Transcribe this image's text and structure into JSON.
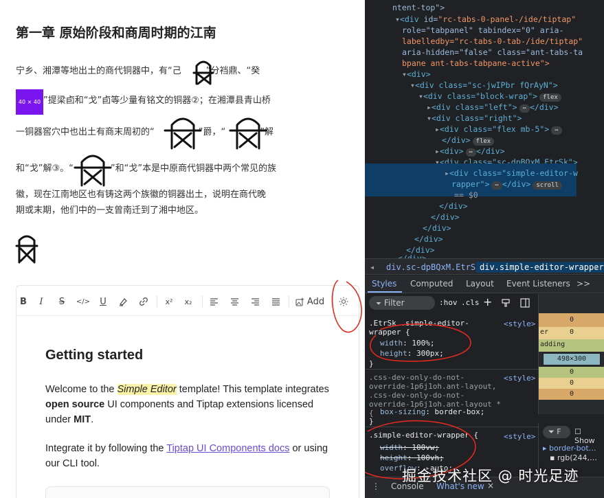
{
  "article": {
    "title": "第一章 原始阶段和商周时期的江南",
    "line1a": "宁乡、湘潭等地出土的商代铜器中，有“己",
    "line1b": "”分裆鼎、“癸",
    "placeholder": "40 × 40",
    "line2": "”提梁卣和“戈”卣等少量有铭文的铜器②；在湘潭县青山桥",
    "line3a": "一铜器窖穴中也出土有商末周初的“",
    "line3b": "”爵，“",
    "line3c": "”解",
    "line4a": "和“戈”解③。“",
    "line4b": "”和“戈”本是中原商代铜器中两个常见的族",
    "line5": "徽，现在江南地区也有铸这两个族徽的铜器出土，说明在商代晚",
    "line6": "期或末期，他们中的一支曾南迁到了湘中地区。"
  },
  "toolbar": {
    "bold": "B",
    "italic": "I",
    "strike": "S",
    "code": "</>",
    "underline": "U",
    "superscript": "x²",
    "subscript": "x₂",
    "add_label": "Add"
  },
  "editor": {
    "heading": "Getting started",
    "p1_pre": "Welcome to the ",
    "p1_hl": "Simple Editor",
    "p1_mid": " template! This template integrates ",
    "p1_b1": "open source",
    "p1_mid2": " UI components and Tiptap extensions licensed under ",
    "p1_b2": "MIT",
    "p1_end": ".",
    "p2_pre": "Integrate it by following the ",
    "p2_link": "Tiptap UI Components docs",
    "p2_end": " or using our CLI tool."
  },
  "dom": {
    "l0": "ntent-top\">",
    "l1_tag": "<div ",
    "l1_attr": "id=",
    "l1_val": "\"rc-tabs-0-panel-/ide/tiptap\"",
    "l2": "role=\"tabpanel\" tabindex=\"0\" aria-",
    "l3": "labelledby=\"rc-tabs-0-tab-/ide/tiptap\"",
    "l4": "aria-hidden=\"false\" class=\"ant-tabs-ta",
    "l5": "bpane ant-tabs-tabpane-active\">",
    "l6": "<div>",
    "l7": "<div class=\"sc-jwIPbr fQrAyN\">",
    "l8": "<div class=\"block-wrap\">",
    "l8_pill": "flex",
    "l9": "<div class=\"left\">",
    "l9_end": "</div>",
    "l10": "<div class=\"right\">",
    "l11": "<div class=\"flex mb-5\">",
    "l12": "</div>",
    "l12_pill": "flex",
    "l13": "<div>",
    "l13_end": "</div>",
    "l14": "<div class=\"sc-dpBQxM EtrSk\">",
    "l15": "<div class=\"simple-editor-w",
    "l16": "rapper\">",
    "l16_mid": "</div>",
    "l16_pill": "scroll",
    "l17": "== $0",
    "c1": "</div>",
    "c2": "</div>",
    "c3": "</div>",
    "c4": "</div>",
    "c5": "</div>",
    "c6": "</div>",
    "c7": "</div>",
    "ellipsis": "⋯"
  },
  "breadcrumb": {
    "item1": "div.sc-dpBQxM.EtrSk",
    "item2": "div.simple-editor-wrapper"
  },
  "styles_tabs": {
    "styles": "Styles",
    "computed": "Computed",
    "layout": "Layout",
    "listeners": "Event Listeners",
    "more": ">>"
  },
  "filter": {
    "placeholder": "Filter",
    "hov": ":hov",
    "cls": ".cls",
    "plus": "+"
  },
  "rules": {
    "r1_sel": ".EtrSk .simple-editor-wrapper {",
    "r1_src": "<style>",
    "r1_p1": "width",
    "r1_v1": "100%;",
    "r1_p2": "height",
    "r1_v2": "300px;",
    "r2_sel": ".css-dev-only-do-not-override-1p6j1oh.ant-layout, .css-dev-only-do-not-override-1p6j1oh.ant-layout * {",
    "r2_src": "<style>",
    "r2_p1": "box-sizing",
    "r2_v1": "border-box;",
    "r3_sel": ".simple-editor-wrapper {",
    "r3_src": "<style>",
    "r3_p1": "width",
    "r3_v1": "100vw;",
    "r3_p2": "height",
    "r3_v2": "100vh;",
    "r3_p3": "overflow",
    "r3_v3": "auto;",
    "brace": "}"
  },
  "boxmodel": {
    "m_top": "0",
    "border_label": "er",
    "b_top": "0",
    "pad_label": "adding",
    "content": "498×300",
    "p_bottom": "0",
    "b_bottom": "0",
    "m_bottom": "0",
    "prop1": "border-bot…",
    "prop2": "rgb(244,…",
    "filter_ph": "F",
    "show": "Show"
  },
  "drawer": {
    "console": "Console",
    "whatsnew": "What's new",
    "close": "×"
  },
  "watermark": "掘金技术社区 @ 时光足迹"
}
